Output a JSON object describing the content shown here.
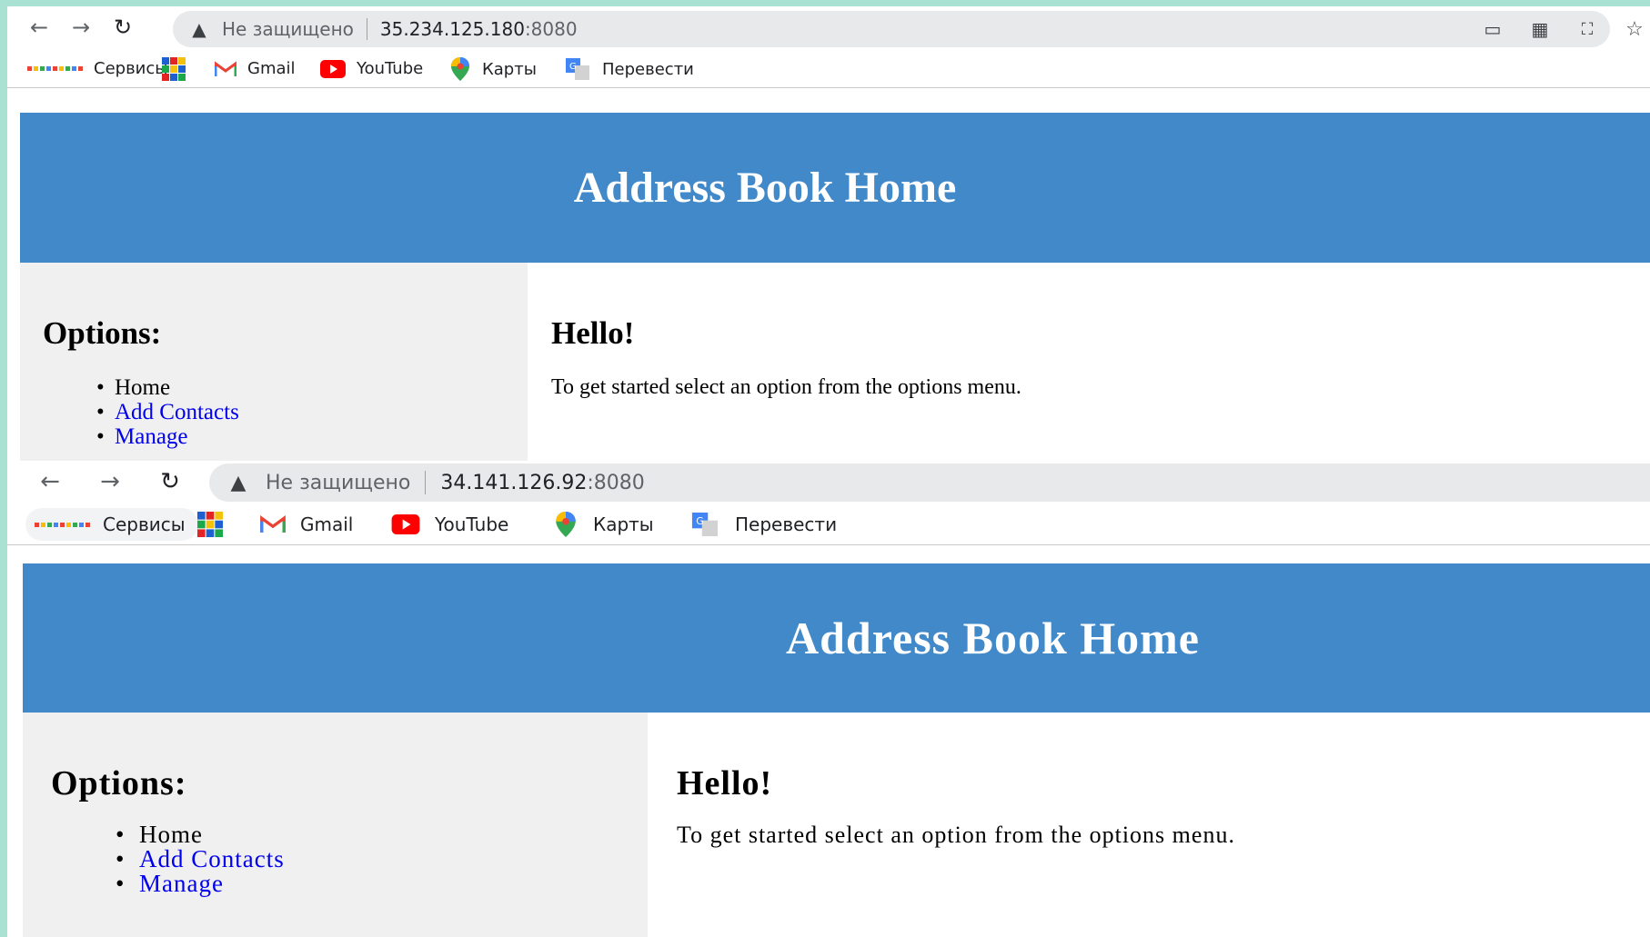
{
  "colors": {
    "header_bg": "#4189c9",
    "sidebar_bg": "#f0f0f0",
    "link": "#0000ee",
    "frame_bg": "#a9e2d3"
  },
  "windows": [
    {
      "browser": {
        "security_label": "Не защищено",
        "url_host": "35.234.125.180",
        "url_port": ":8080",
        "bookmarks": [
          {
            "label": "Сервисы",
            "icon": "apps-grid-icon"
          },
          {
            "label": "",
            "icon": "colorful-tiles-icon"
          },
          {
            "label": "Gmail",
            "icon": "gmail-icon"
          },
          {
            "label": "YouTube",
            "icon": "youtube-icon"
          },
          {
            "label": "Карты",
            "icon": "maps-pin-icon"
          },
          {
            "label": "Перевести",
            "icon": "translate-icon"
          }
        ]
      },
      "page": {
        "header_title": "Address Book Home",
        "sidebar_title": "Options:",
        "menu": [
          {
            "label": "Home",
            "link": false
          },
          {
            "label": "Add Contacts",
            "link": true
          },
          {
            "label": "Manage",
            "link": true
          }
        ],
        "greeting": "Hello!",
        "intro": "To get started select an option from the options menu."
      }
    },
    {
      "browser": {
        "security_label": "Не защищено",
        "url_host": "34.141.126.92",
        "url_port": ":8080",
        "bookmarks": [
          {
            "label": "Сервисы",
            "icon": "apps-grid-icon"
          },
          {
            "label": "",
            "icon": "colorful-tiles-icon"
          },
          {
            "label": "Gmail",
            "icon": "gmail-icon"
          },
          {
            "label": "YouTube",
            "icon": "youtube-icon"
          },
          {
            "label": "Карты",
            "icon": "maps-pin-icon"
          },
          {
            "label": "Перевести",
            "icon": "translate-icon"
          }
        ]
      },
      "page": {
        "header_title": "Address Book Home",
        "sidebar_title": "Options:",
        "menu": [
          {
            "label": "Home",
            "link": false
          },
          {
            "label": "Add Contacts",
            "link": true
          },
          {
            "label": "Manage",
            "link": true
          }
        ],
        "greeting": "Hello!",
        "intro": "To get started select an option from the options menu."
      }
    }
  ]
}
